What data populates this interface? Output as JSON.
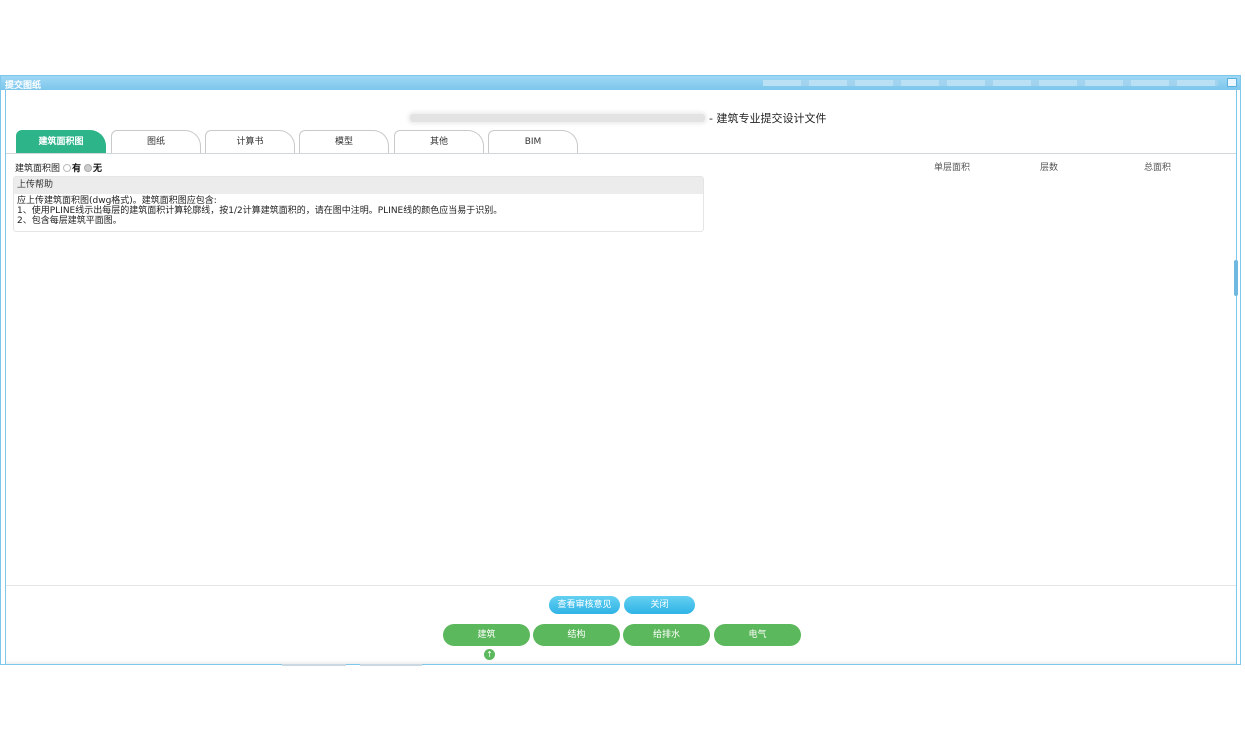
{
  "window": {
    "title": "提交图纸"
  },
  "header": {
    "suffix": "- 建筑专业提交设计文件"
  },
  "tabs": [
    {
      "label": "建筑面积图",
      "active": true
    },
    {
      "label": "图纸"
    },
    {
      "label": "计算书"
    },
    {
      "label": "模型"
    },
    {
      "label": "其他"
    },
    {
      "label": "BIM"
    }
  ],
  "area_drawing": {
    "label": "建筑面积图",
    "options": [
      {
        "label": "有",
        "checked": false
      },
      {
        "label": "无",
        "checked": true
      }
    ]
  },
  "columns": {
    "floor_area": "单层面积",
    "floors": "层数",
    "total_area": "总面积"
  },
  "help": {
    "title": "上传帮助",
    "lines": [
      "应上传建筑面积图(dwg格式)。建筑面积图应包含:",
      "1、使用PLINE线示出每层的建筑面积计算轮廓线，按1/2计算建筑面积的，请在图中注明。PLINE线的颜色应当易于识别。",
      "2、包含每层建筑平面图。"
    ]
  },
  "actions": {
    "view_opinions": "查看审核意见",
    "close": "关闭"
  },
  "disciplines": [
    "建筑",
    "结构",
    "给排水",
    "电气"
  ],
  "colors": {
    "tab_active": "#2db489",
    "button_green": "#5cb85c",
    "button_blue": "#2fb3e6",
    "window_border": "#7ec6ea"
  }
}
